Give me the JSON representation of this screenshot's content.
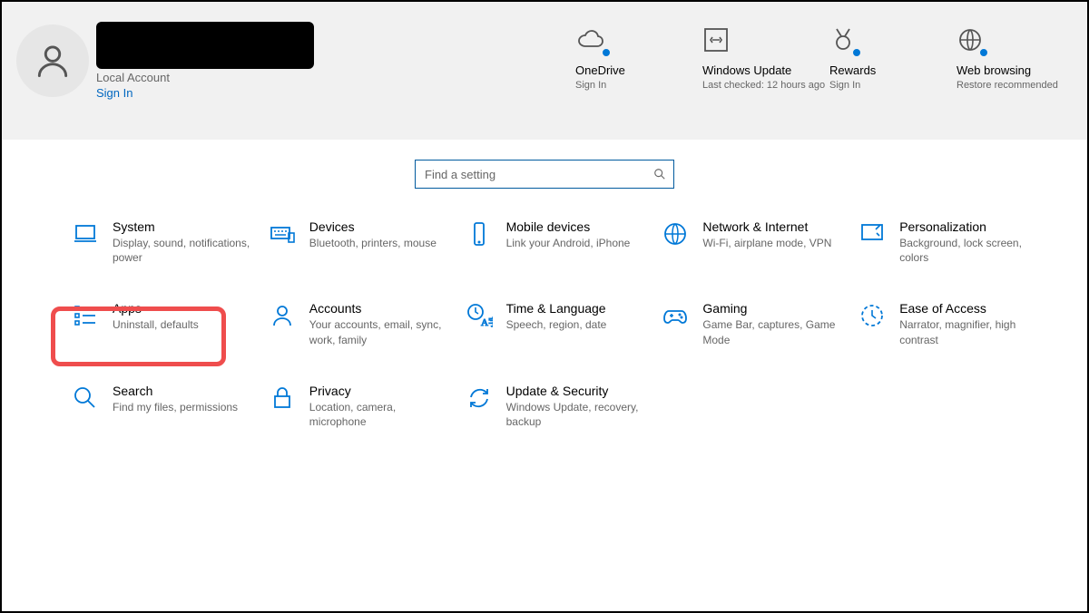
{
  "profile": {
    "account_type": "Local Account",
    "sign_in": "Sign In"
  },
  "quick": [
    {
      "title": "OneDrive",
      "sub": "Sign In"
    },
    {
      "title": "Windows Update",
      "sub": "Last checked: 12 hours ago"
    },
    {
      "title": "Rewards",
      "sub": "Sign In"
    },
    {
      "title": "Web browsing",
      "sub": "Restore recommended"
    }
  ],
  "search": {
    "placeholder": "Find a setting"
  },
  "categories": [
    {
      "title": "System",
      "desc": "Display, sound, notifications, power"
    },
    {
      "title": "Devices",
      "desc": "Bluetooth, printers, mouse"
    },
    {
      "title": "Mobile devices",
      "desc": "Link your Android, iPhone"
    },
    {
      "title": "Network & Internet",
      "desc": "Wi-Fi, airplane mode, VPN"
    },
    {
      "title": "Personalization",
      "desc": "Background, lock screen, colors"
    },
    {
      "title": "Apps",
      "desc": "Uninstall, defaults"
    },
    {
      "title": "Accounts",
      "desc": "Your accounts, email, sync, work, family"
    },
    {
      "title": "Time & Language",
      "desc": "Speech, region, date"
    },
    {
      "title": "Gaming",
      "desc": "Game Bar, captures, Game Mode"
    },
    {
      "title": "Ease of Access",
      "desc": "Narrator, magnifier, high contrast"
    },
    {
      "title": "Search",
      "desc": "Find my files, permissions"
    },
    {
      "title": "Privacy",
      "desc": "Location, camera, microphone"
    },
    {
      "title": "Update & Security",
      "desc": "Windows Update, recovery, backup"
    }
  ]
}
